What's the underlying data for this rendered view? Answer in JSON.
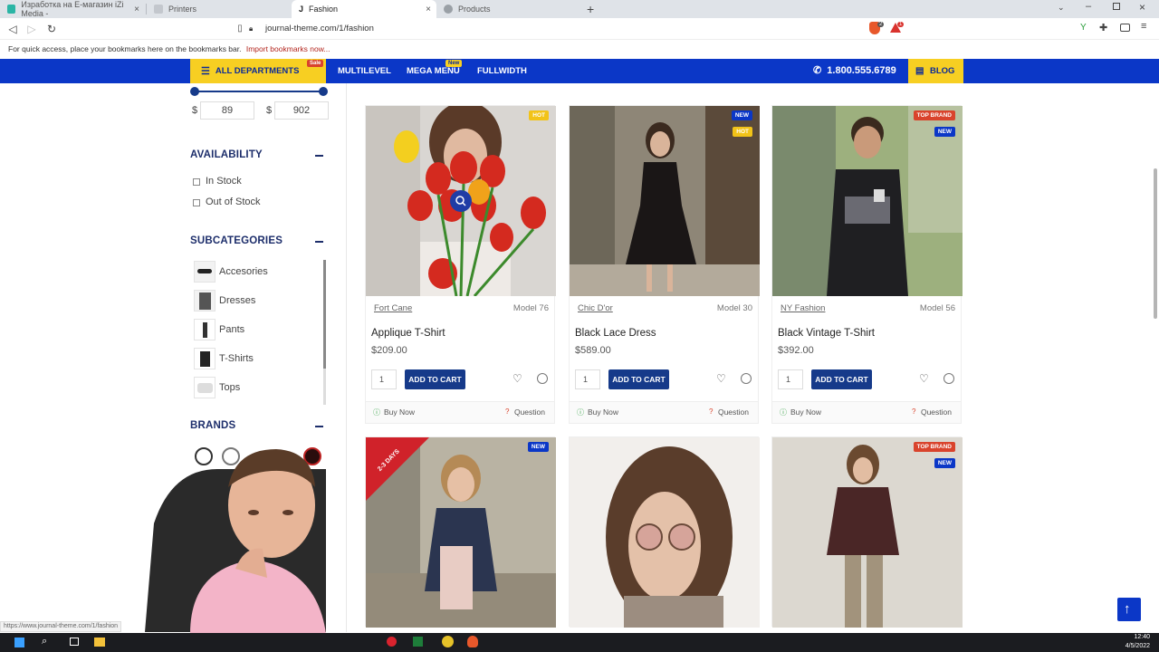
{
  "browser": {
    "tabs": [
      {
        "title": "Изработка на Е-магазин iZi Media - ",
        "color": "#2bb5a5"
      },
      {
        "title": "Printers",
        "color": "#8a8f98"
      },
      {
        "title": "Fashion",
        "color": "#222222"
      },
      {
        "title": "Products",
        "color": "#8a8f98"
      }
    ],
    "url": "journal-theme.com/1/fashion",
    "bookmarks_text": "For quick access, place your bookmarks here on the bookmarks bar.",
    "bookmarks_link": "Import bookmarks now...",
    "brave_count": "2",
    "alert_count": "1"
  },
  "nav": {
    "departments": "ALL DEPARTMENTS",
    "sale_badge": "Sale",
    "multilevel": "MULTILEVEL",
    "mega_menu": "MEGA MENU",
    "new_badge": "New",
    "fullwidth": "FULLWIDTH",
    "phone": "1.800.555.6789",
    "blog": "BLOG"
  },
  "sidebar": {
    "price": {
      "currency": "$",
      "min": "89",
      "max": "902"
    },
    "availability": {
      "title": "AVAILABILITY",
      "options": [
        "In Stock",
        "Out of Stock"
      ]
    },
    "subcategories": {
      "title": "SUBCATEGORIES",
      "items": [
        "Accesories",
        "Dresses",
        "Pants",
        "T-Shirts",
        "Tops"
      ]
    },
    "brands": {
      "title": "BRANDS"
    }
  },
  "products": [
    {
      "brand": "Fort Cane",
      "model": "Model 76",
      "name": "Applique T-Shirt",
      "price": "$209.00",
      "qty": "1",
      "tags": [
        "HOT"
      ]
    },
    {
      "brand": "Chic D'or",
      "model": "Model 30",
      "name": "Black Lace Dress",
      "price": "$589.00",
      "qty": "1",
      "tags": [
        "NEW",
        "HOT"
      ]
    },
    {
      "brand": "NY Fashion",
      "model": "Model 56",
      "name": "Black Vintage T-Shirt",
      "price": "$392.00",
      "qty": "1",
      "tags": [
        "TOP BRAND",
        "NEW"
      ]
    },
    {
      "tags": [
        "NEW"
      ],
      "ribbon": "2-3 DAYS"
    },
    {
      "tags": []
    },
    {
      "tags": [
        "TOP BRAND",
        "NEW"
      ]
    }
  ],
  "card_labels": {
    "add_to_cart": "ADD TO CART",
    "buy_now": "Buy Now",
    "question": "Question"
  },
  "status_url": "https://www.journal-theme.com/1/fashion",
  "clock": {
    "time": "12:40",
    "date": "4/5/2022"
  },
  "colors": {
    "nav_blue": "#0b37c7",
    "yellow": "#f7cf22",
    "cart_blue": "#163a8a",
    "hot": "#f2c318",
    "new": "#0b37c7",
    "top_brand": "#d9432c"
  }
}
